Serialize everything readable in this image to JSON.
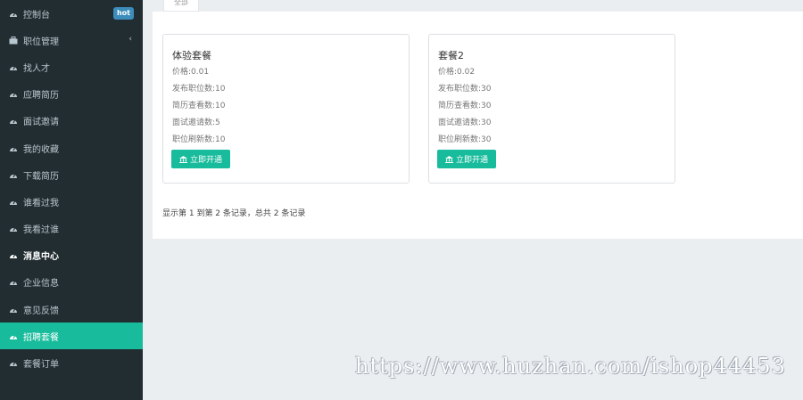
{
  "sidebar": {
    "items": [
      {
        "label": "控制台",
        "icon": "dashboard-icon",
        "badge": "hot"
      },
      {
        "label": "职位管理",
        "icon": "briefcase-icon",
        "chevron": "‹"
      },
      {
        "label": "找人才",
        "icon": "dashboard-icon"
      },
      {
        "label": "应聘简历",
        "icon": "dashboard-icon"
      },
      {
        "label": "面试邀请",
        "icon": "dashboard-icon"
      },
      {
        "label": "我的收藏",
        "icon": "dashboard-icon"
      },
      {
        "label": "下载简历",
        "icon": "dashboard-icon"
      },
      {
        "label": "谁看过我",
        "icon": "dashboard-icon"
      },
      {
        "label": "我看过谁",
        "icon": "dashboard-icon"
      },
      {
        "label": "消息中心",
        "icon": "dashboard-icon"
      },
      {
        "label": "企业信息",
        "icon": "dashboard-icon"
      },
      {
        "label": "意见反馈",
        "icon": "dashboard-icon"
      },
      {
        "label": "招聘套餐",
        "icon": "dashboard-icon",
        "active": true
      },
      {
        "label": "套餐订单",
        "icon": "dashboard-icon"
      }
    ]
  },
  "tabs": [
    {
      "label": "全部"
    }
  ],
  "packages": [
    {
      "title": "体验套餐",
      "price": "价格:0.01",
      "jobs": "发布职位数:10",
      "resume_views": "简历查看数:10",
      "interviews": "面试邀请数:5",
      "refreshes": "职位刷新数:10",
      "button": "立即开通"
    },
    {
      "title": "套餐2",
      "price": "价格:0.02",
      "jobs": "发布职位数:30",
      "resume_views": "简历查看数:30",
      "interviews": "面试邀请数:30",
      "refreshes": "职位刷新数:30",
      "button": "立即开通"
    }
  ],
  "pagination": {
    "summary": "显示第 1 到第 2 条记录，总共 2 条记录"
  },
  "watermark": "https://www.huzhan.com/ishop44453",
  "colors": {
    "sidebar": "#222d32",
    "accent": "#18bc9c",
    "badge": "#3c8dbc"
  }
}
